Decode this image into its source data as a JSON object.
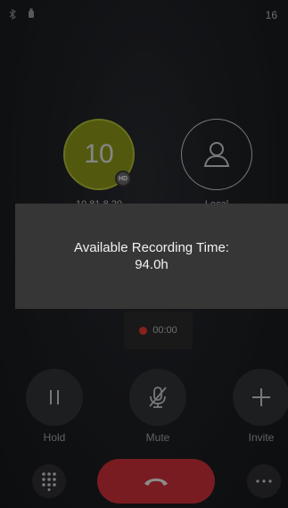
{
  "status_bar": {
    "time": "16"
  },
  "parties": {
    "remote": {
      "number": "10",
      "label": "10.81.8.20",
      "badge": "HD"
    },
    "local": {
      "label": "Local"
    }
  },
  "toast": {
    "line1": "Available Recording Time:",
    "line2": "94.0h"
  },
  "recording": {
    "elapsed": "00:00"
  },
  "actions": {
    "hold": "Hold",
    "mute": "Mute",
    "invite": "Invite"
  },
  "colors": {
    "end_call": "#d0313a",
    "recording": "#e53935",
    "remote_avatar": "#8d9a1b"
  }
}
